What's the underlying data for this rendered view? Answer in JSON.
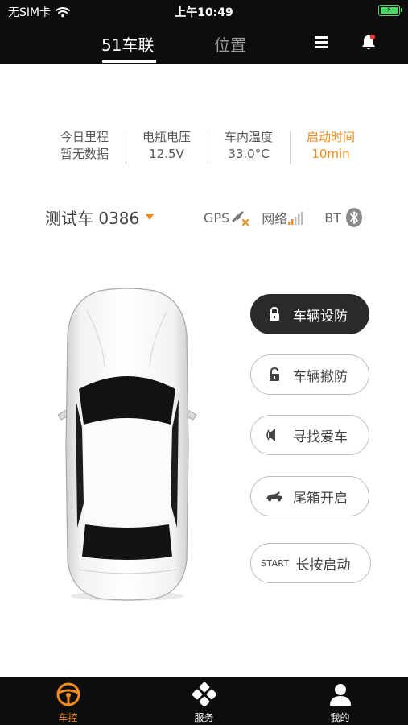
{
  "status_bar": {
    "carrier": "无SIM卡",
    "wifi_icon": "wifi-icon",
    "time": "上午10:49",
    "battery_icon": "battery-charging-icon"
  },
  "nav": {
    "tab_active": "51车联",
    "tab_inactive": "位置",
    "menu_icon": "menu-icon",
    "bell_icon": "bell-icon",
    "notification_color": "#e53935"
  },
  "stats": [
    {
      "label": "今日里程",
      "value": "暂无数据"
    },
    {
      "label": "电瓶电压",
      "value": "12.5V"
    },
    {
      "label": "车内温度",
      "value": "33.0°C"
    },
    {
      "label": "启动时间",
      "value": "10min"
    }
  ],
  "vehicle": {
    "name": "测试车 0386",
    "gps_label": "GPS",
    "network_label": "网络",
    "bt_label": "BT"
  },
  "actions": {
    "arm": "车辆设防",
    "disarm": "车辆撤防",
    "find": "寻找爱车",
    "trunk": "尾箱开启",
    "start_tag": "START",
    "start": "长按启动"
  },
  "bottom_nav": {
    "control": "车控",
    "service": "服务",
    "mine": "我的"
  },
  "colors": {
    "accent": "#f28a1c",
    "header_bg": "#0d0d0d",
    "active_button_bg": "#2a2a2a"
  }
}
